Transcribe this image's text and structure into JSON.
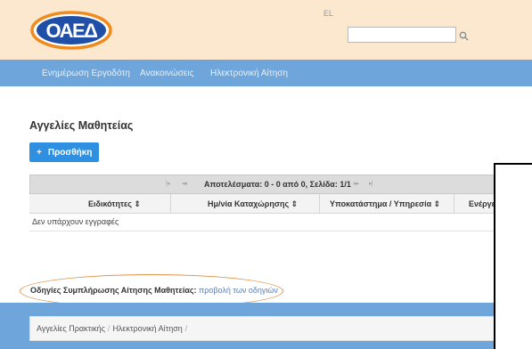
{
  "header": {
    "logo_text": "ΟΑΕΔ",
    "language": "EL",
    "search": {
      "value": "",
      "placeholder": ""
    },
    "search_icon": "search-icon",
    "brand_blue": "#1f4fa6",
    "brand_orange": "#f08a1c"
  },
  "nav": {
    "items": [
      {
        "label": "Ενημέρωση Εργοδότη"
      },
      {
        "label": "Ανακοινώσεις"
      },
      {
        "label": "Ηλεκτρονική Αίτηση"
      }
    ]
  },
  "main": {
    "title": "Αγγελίες Μαθητείας",
    "add_button": {
      "icon": "+",
      "label": "Προσθήκη"
    },
    "pager": {
      "first": "|◂",
      "prev": "◂◂",
      "text": "Αποτελέσματα: 0 - 0 από 0, Σελίδα: 1/1",
      "next": "▸▸",
      "last": "▸|"
    },
    "table": {
      "columns": [
        "Ειδικότητες ⇕",
        "Ημ/νία Καταχώρησης ⇕",
        "Υποκατάστημα / Υπηρεσία ⇕",
        "Ενέργειες"
      ],
      "empty_text": "Δεν υπάρχουν εγγραφές"
    },
    "instructions": {
      "label": "Οδηγίες Συμπλήρωσης Αίτησης Μαθητείας:",
      "link": "προβολή των οδηγιών"
    }
  },
  "footer": {
    "breadcrumb": [
      "Αγγελίες Πρακτικής",
      "Ηλεκτρονική Αίτηση"
    ],
    "separator": "/"
  },
  "colors": {
    "header_bg": "#fbe8cf",
    "nav_bg": "#6ea5da",
    "button_blue": "#2f8fe0",
    "highlight": "#e0914a"
  }
}
